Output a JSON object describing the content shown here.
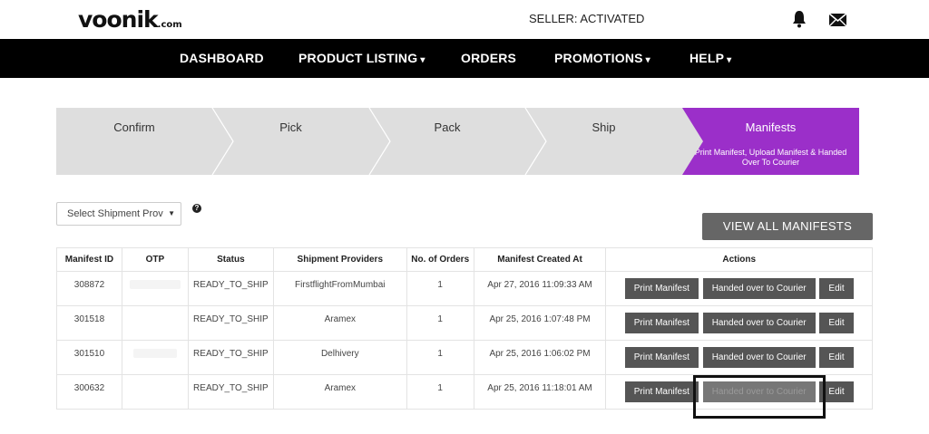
{
  "header": {
    "logo_main": "voonik",
    "logo_suffix": ".com",
    "seller_status": "SELLER: ACTIVATED",
    "icons": [
      "bell-icon",
      "mail-icon"
    ]
  },
  "nav": {
    "items": [
      {
        "label": "DASHBOARD",
        "caret": ""
      },
      {
        "label": "PRODUCT LISTING",
        "caret": "▾"
      },
      {
        "label": "ORDERS",
        "caret": ""
      },
      {
        "label": "PROMOTIONS",
        "caret": "▾"
      },
      {
        "label": "HELP",
        "caret": "▾"
      }
    ]
  },
  "steps": {
    "items": [
      {
        "label": "Confirm"
      },
      {
        "label": "Pick"
      },
      {
        "label": "Pack"
      },
      {
        "label": "Ship"
      },
      {
        "label": "Manifests",
        "desc": "Print Manifest, Upload Manifest & Handed Over To Courier"
      }
    ],
    "active_color": "#9b2fc9"
  },
  "filter": {
    "select_value": "Select Shipment Prov",
    "help_symbol": "?"
  },
  "view_all_label": "VIEW ALL MANIFESTS",
  "table": {
    "headers": [
      "Manifest ID",
      "OTP",
      "Status",
      "Shipment Providers",
      "No. of Orders",
      "Manifest Created At",
      "Actions"
    ],
    "rows": [
      {
        "id": "308872",
        "otp": "",
        "status": "READY_TO_SHIP",
        "provider": "FirstflightFromMumbai",
        "orders": "1",
        "created": "Apr 27, 2016 11:09:33 AM"
      },
      {
        "id": "301518",
        "otp": "",
        "status": "READY_TO_SHIP",
        "provider": "Aramex",
        "orders": "1",
        "created": "Apr 25, 2016 1:07:48 PM"
      },
      {
        "id": "301510",
        "otp": "",
        "status": "READY_TO_SHIP",
        "provider": "Delhivery",
        "orders": "1",
        "created": "Apr 25, 2016 1:06:02 PM"
      },
      {
        "id": "300632",
        "otp": "",
        "status": "READY_TO_SHIP",
        "provider": "Aramex",
        "orders": "1",
        "created": "Apr 25, 2016 11:18:01 AM"
      }
    ],
    "actions": {
      "print": "Print Manifest",
      "handed": "Handed over to Courier",
      "edit": "Edit"
    }
  }
}
